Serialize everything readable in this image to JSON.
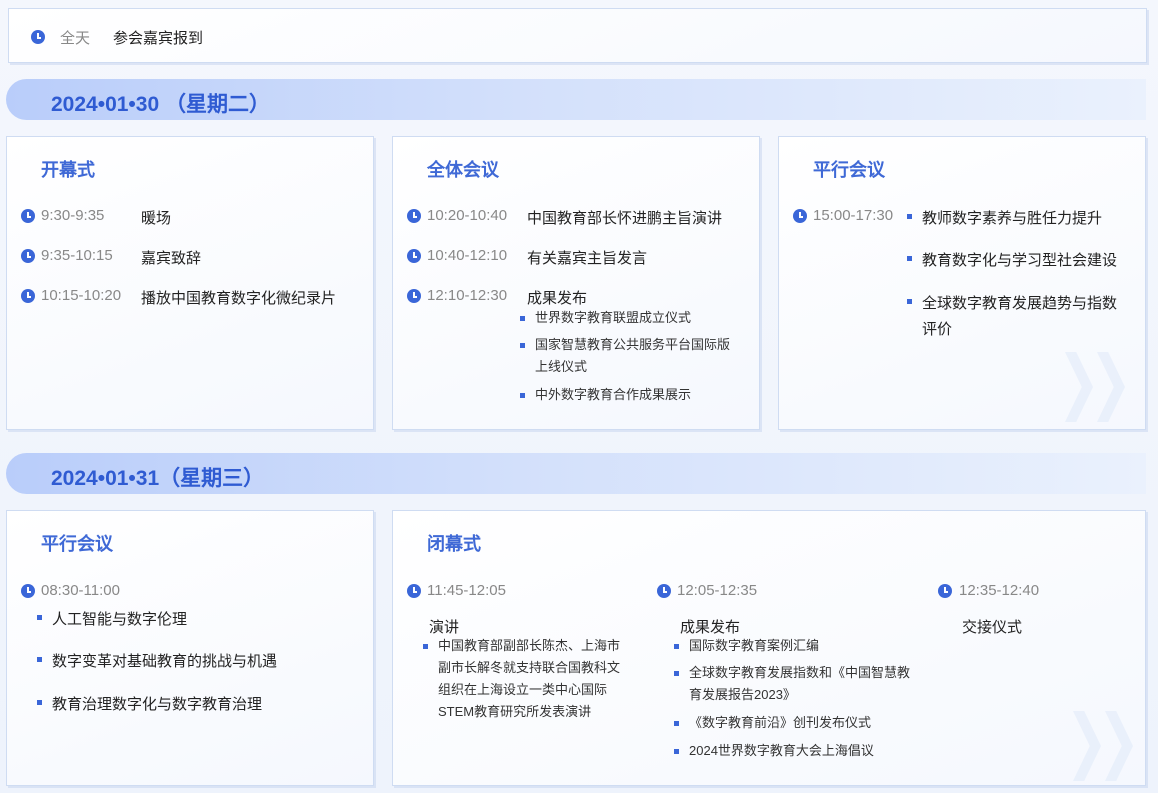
{
  "top_row": {
    "time": "全天",
    "text": "参会嘉宾报到"
  },
  "day1": {
    "date": "2024•01•30 （星期二）",
    "opening": {
      "title": "开幕式",
      "items": [
        {
          "time": "9:30-9:35",
          "text": "暖场"
        },
        {
          "time": "9:35-10:15",
          "text": "嘉宾致辞"
        },
        {
          "time": "10:15-10:20",
          "text": "播放中国教育数字化微纪录片"
        }
      ]
    },
    "plenary": {
      "title": "全体会议",
      "items": [
        {
          "time": "10:20-10:40",
          "text": "中国教育部长怀进鹏主旨演讲"
        },
        {
          "time": "10:40-12:10",
          "text": "有关嘉宾主旨发言"
        },
        {
          "time": "12:10-12:30",
          "text": "成果发布"
        }
      ],
      "sub_items": [
        "世界数字教育联盟成立仪式",
        "国家智慧教育公共服务平台国际版上线仪式",
        "中外数字教育合作成果展示"
      ]
    },
    "parallel": {
      "title": "平行会议",
      "time": "15:00-17:30",
      "topics": [
        "教师数字素养与胜任力提升",
        "教育数字化与学习型社会建设",
        "全球数字教育发展趋势与指数评价"
      ]
    }
  },
  "day2": {
    "date": "2024•01•31（星期三）",
    "parallel": {
      "title": "平行会议",
      "time": "08:30-11:00",
      "topics": [
        "人工智能与数字伦理",
        "数字变革对基础教育的挑战与机遇",
        "教育治理数字化与数字教育治理"
      ]
    },
    "closing": {
      "title": "闭幕式",
      "col1": {
        "time": "11:45-12:05",
        "heading": "演讲",
        "items": [
          "中国教育部副部长陈杰、上海市副市长解冬就支持联合国教科文组织在上海设立一类中心国际STEM教育研究所发表演讲"
        ]
      },
      "col2": {
        "time": "12:05-12:35",
        "heading": "成果发布",
        "items": [
          "国际数字教育案例汇编",
          "全球数字教育发展指数和《中国智慧教育发展报告2023》",
          "《数字教育前沿》创刊发布仪式",
          "2024世界数字教育大会上海倡议"
        ]
      },
      "col3": {
        "time": "12:35-12:40",
        "heading": "交接仪式"
      }
    }
  }
}
